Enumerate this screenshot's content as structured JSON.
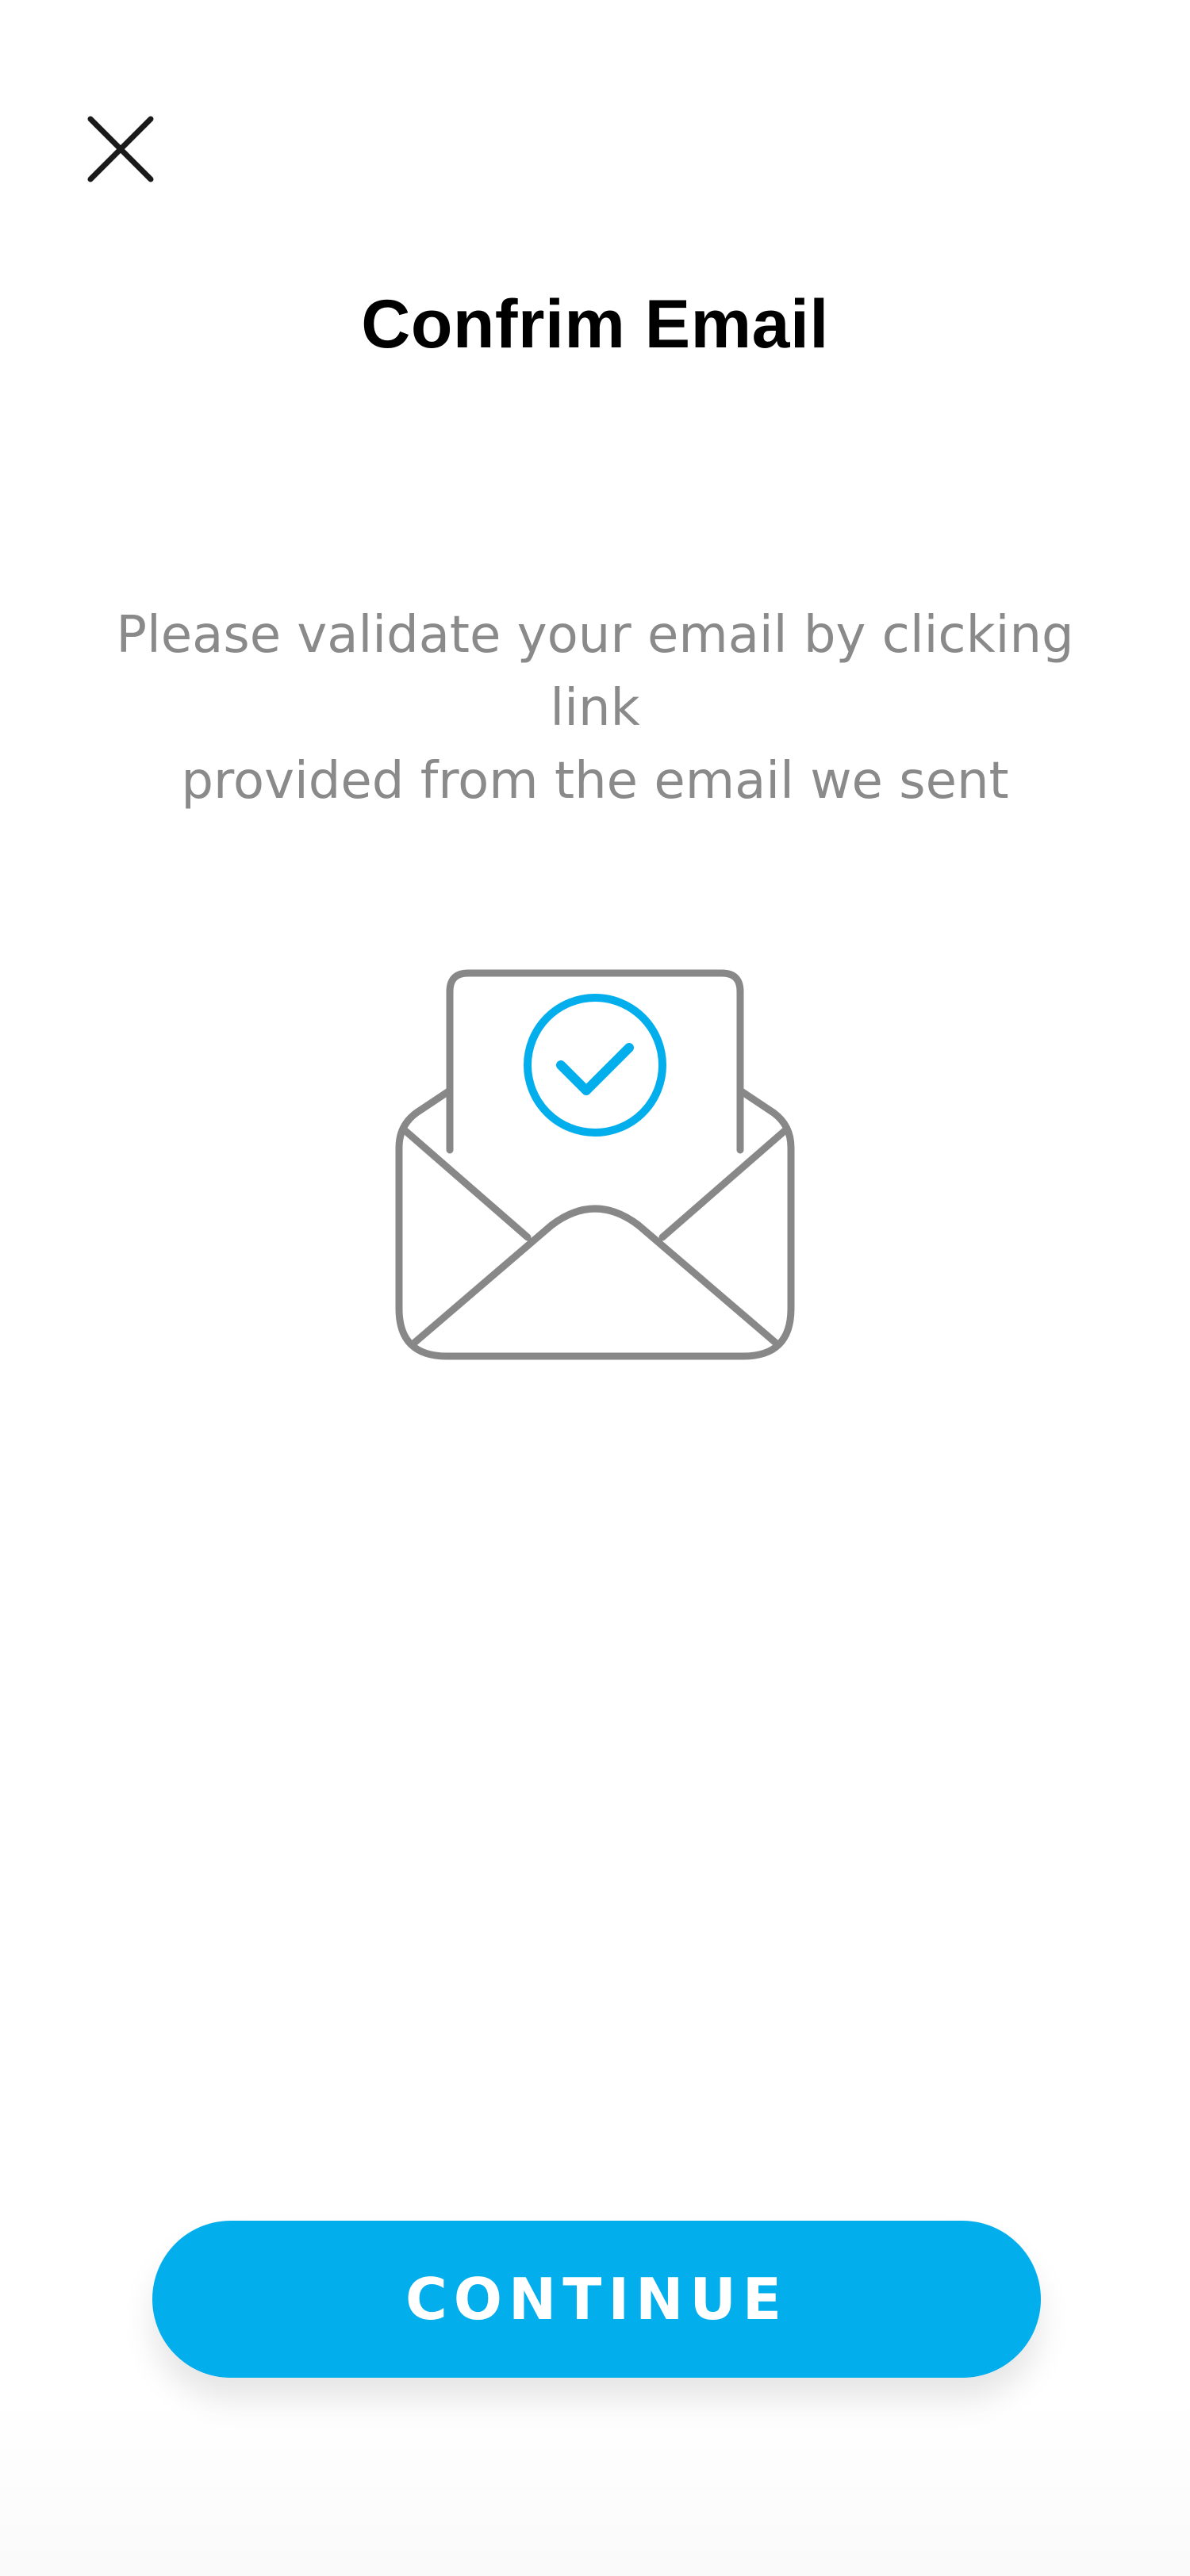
{
  "header": {
    "close_icon": "close-icon",
    "title": "Confrim Email"
  },
  "main": {
    "message_line1": "Please validate your email by clicking link",
    "message_line2": "provided from the email we sent",
    "illustration_icon": "open-envelope-check-icon"
  },
  "footer": {
    "continue_label": "CONTINUE"
  },
  "colors": {
    "accent": "#03aeec",
    "title": "#000000",
    "message": "#8a8a8a",
    "illustration_stroke": "#888888"
  }
}
